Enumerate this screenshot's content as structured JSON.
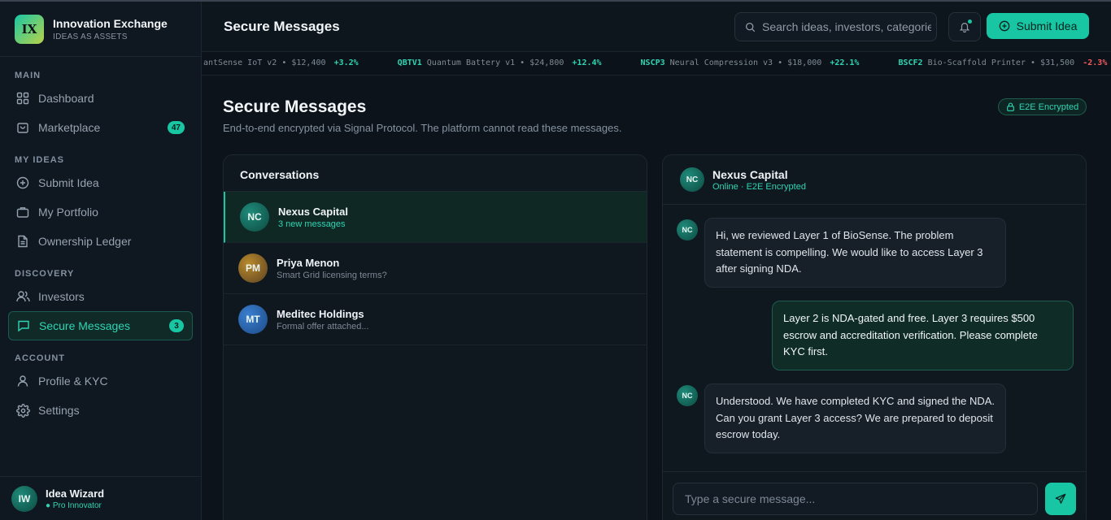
{
  "brand": {
    "logo_text": "IX",
    "title": "Innovation Exchange",
    "subtitle": "IDEAS AS ASSETS"
  },
  "sidebar": {
    "sections": [
      "MAIN",
      "MY IDEAS",
      "DISCOVERY",
      "ACCOUNT"
    ],
    "items": [
      {
        "label": "Dashboard",
        "icon": "grid-icon"
      },
      {
        "label": "Marketplace",
        "icon": "bag-icon",
        "badge": "47"
      },
      {
        "label": "Submit Idea",
        "icon": "plus-circle-icon"
      },
      {
        "label": "My Portfolio",
        "icon": "briefcase-icon"
      },
      {
        "label": "Ownership Ledger",
        "icon": "document-icon"
      },
      {
        "label": "Investors",
        "icon": "users-icon"
      },
      {
        "label": "Secure Messages",
        "icon": "message-icon",
        "badge": "3",
        "active": true
      },
      {
        "label": "Profile & KYC",
        "icon": "user-icon"
      },
      {
        "label": "Settings",
        "icon": "gear-icon"
      }
    ]
  },
  "user": {
    "initials": "IW",
    "name": "Idea Wizard",
    "role": "● Pro Innovator"
  },
  "header": {
    "title": "Secure Messages",
    "search_placeholder": "Search ideas, investors, categories",
    "submit_label": "Submit Idea"
  },
  "ticker": [
    {
      "symbol": "",
      "name": "antSense IoT v2",
      "price": "$12,400",
      "change": "+3.2%",
      "dir": "up"
    },
    {
      "symbol": "QBTV1",
      "name": "Quantum Battery v1",
      "price": "$24,800",
      "change": "+12.4%",
      "dir": "up"
    },
    {
      "symbol": "NSCP3",
      "name": "Neural Compression v3",
      "price": "$18,000",
      "change": "+22.1%",
      "dir": "up"
    },
    {
      "symbol": "BSCF2",
      "name": "Bio-Scaffold Printer",
      "price": "$31,500",
      "change": "-2.3%",
      "dir": "down"
    }
  ],
  "page": {
    "title": "Secure Messages",
    "subtitle": "End-to-end encrypted via Signal Protocol. The platform cannot read these messages.",
    "badge": "E2E Encrypted"
  },
  "conversations": {
    "heading": "Conversations",
    "items": [
      {
        "initials": "NC",
        "name": "Nexus Capital",
        "preview": "3 new messages"
      },
      {
        "initials": "PM",
        "name": "Priya Menon",
        "preview": "Smart Grid licensing terms?"
      },
      {
        "initials": "MT",
        "name": "Meditec Holdings",
        "preview": "Formal offer attached..."
      }
    ]
  },
  "chat": {
    "initials": "NC",
    "name": "Nexus Capital",
    "status": "Online · E2E Encrypted",
    "messages": [
      {
        "from": "NC",
        "text": "Hi, we reviewed Layer 1 of BioSense. The problem statement is compelling. We would like to access Layer 3 after signing NDA."
      },
      {
        "from": "me",
        "text": "Layer 2 is NDA-gated and free. Layer 3 requires $500 escrow and accreditation verification. Please complete KYC first."
      },
      {
        "from": "NC",
        "text": "Understood. We have completed KYC and signed the NDA. Can you grant Layer 3 access? We are prepared to deposit escrow today."
      }
    ],
    "composer_placeholder": "Type a secure message..."
  },
  "colors": {
    "accent": "#19c6a4",
    "negative": "#f25c5c",
    "background": "#0c131b"
  }
}
